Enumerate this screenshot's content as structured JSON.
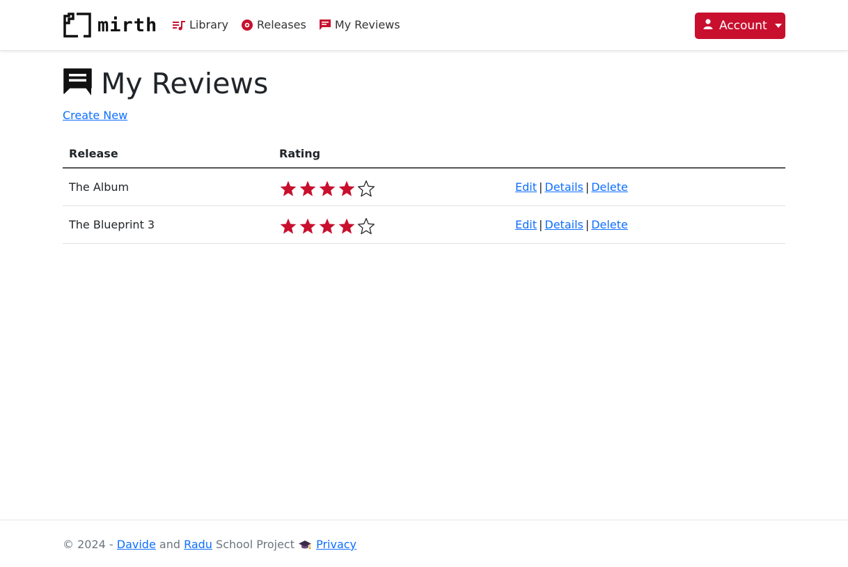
{
  "brand": {
    "name": "mirth"
  },
  "nav": {
    "items": [
      {
        "label": "Library",
        "icon": "music-list-icon"
      },
      {
        "label": "Releases",
        "icon": "vinyl-record-icon"
      },
      {
        "label": "My Reviews",
        "icon": "review-comment-icon"
      }
    ]
  },
  "account": {
    "label": "Account",
    "icon": "person-icon"
  },
  "page": {
    "title": "My Reviews",
    "create_new": "Create New"
  },
  "table": {
    "headers": {
      "release": "Release",
      "rating": "Rating",
      "actions": ""
    },
    "rows": [
      {
        "release": "The Album",
        "rating": 4,
        "max_rating": 5,
        "edit": "Edit",
        "details": "Details",
        "delete": "Delete"
      },
      {
        "release": "The Blueprint 3",
        "rating": 4,
        "max_rating": 5,
        "edit": "Edit",
        "details": "Details",
        "delete": "Delete"
      }
    ],
    "separator": "|"
  },
  "footer": {
    "copyright": "© 2024 - ",
    "author1": "Davide",
    "and": " and ",
    "author2": "Radu",
    "suffix": " School Project ",
    "privacy": "Privacy"
  },
  "colors": {
    "accent": "#c8102e",
    "link": "#0d6efd"
  }
}
